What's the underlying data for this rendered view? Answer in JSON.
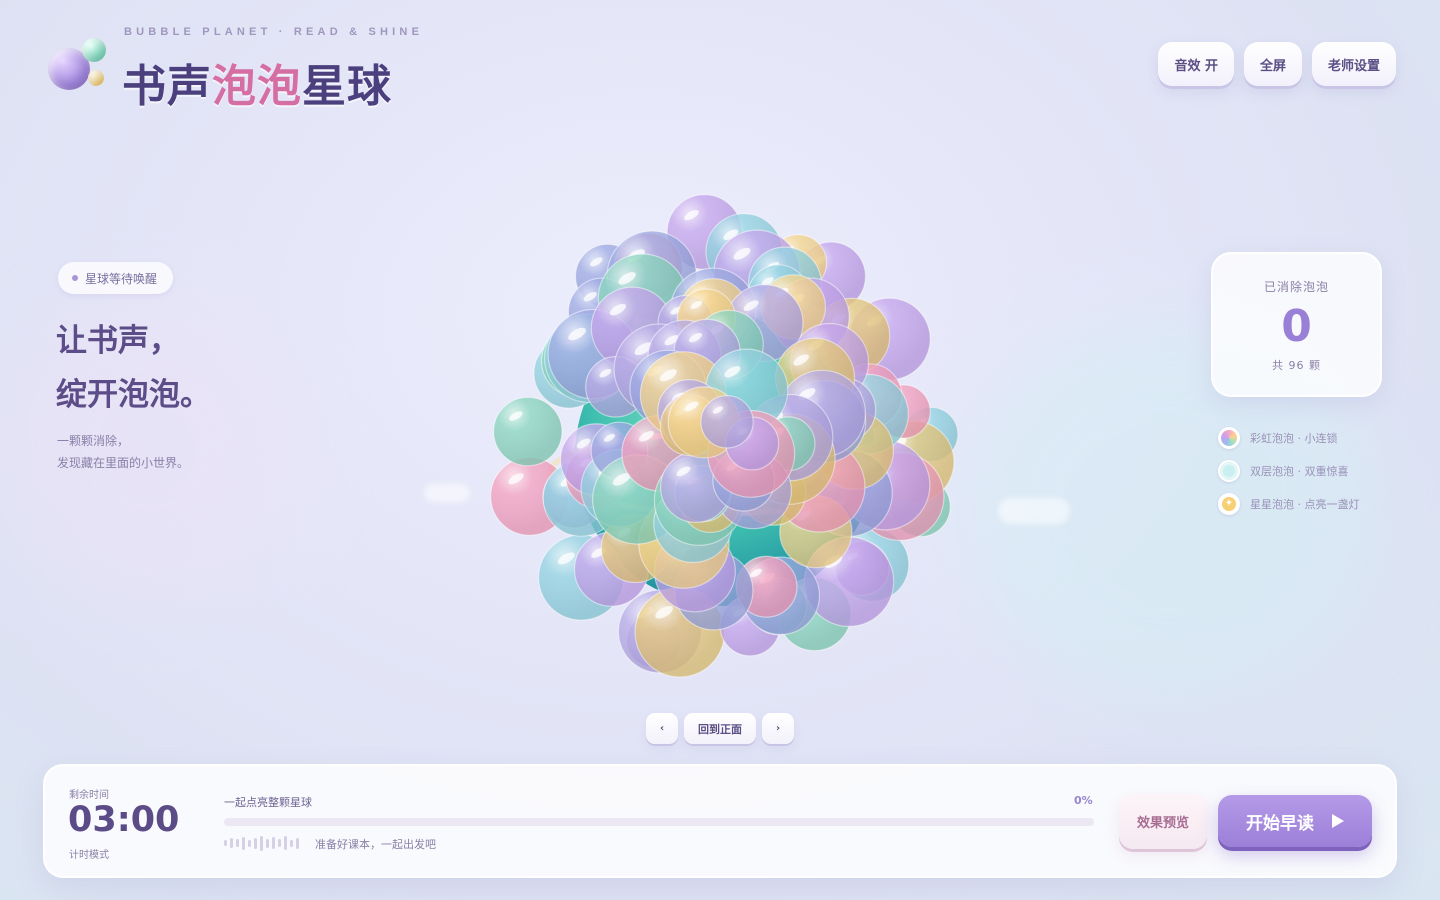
{
  "brand": {
    "subtitle": "BUBBLE PLANET · READ & SHINE",
    "title_part1": "书声",
    "title_highlight": "泡泡",
    "title_part2": "星球"
  },
  "top_actions": {
    "sound": "音效 开",
    "fullscreen": "全屏",
    "teacher_settings": "老师设置"
  },
  "intro": {
    "status": "星球等待唤醒",
    "headline_line1": "让书声，",
    "headline_line2": "绽开泡泡。",
    "desc_line1": "一颗颗消除，",
    "desc_line2": "发现藏在里面的小世界。"
  },
  "stats": {
    "label": "已消除泡泡",
    "value": "0",
    "total": "共 96 颗"
  },
  "legend": [
    {
      "icon": "rainbow-bubble-icon",
      "label": "彩虹泡泡 · 小连锁"
    },
    {
      "icon": "double-bubble-icon",
      "label": "双层泡泡 · 双重惊喜"
    },
    {
      "icon": "star-bubble-icon",
      "label": "星星泡泡 · 点亮一盏灯"
    }
  ],
  "view_controls": {
    "prev": "‹",
    "reset": "回到正面",
    "next": "›"
  },
  "bottom": {
    "timer_label": "剩余时间",
    "timer_value": "03:00",
    "timer_mode": "计时模式",
    "goal": "一起点亮整颗星球",
    "progress_text": "0%",
    "progress": 0,
    "hint": "准备好课本，一起出发吧",
    "preview": "效果预览",
    "start": "开始早读"
  },
  "colors": {
    "accent": "#9c7fd8",
    "title": "#4b3f7e",
    "highlight": "#d56ea3"
  }
}
